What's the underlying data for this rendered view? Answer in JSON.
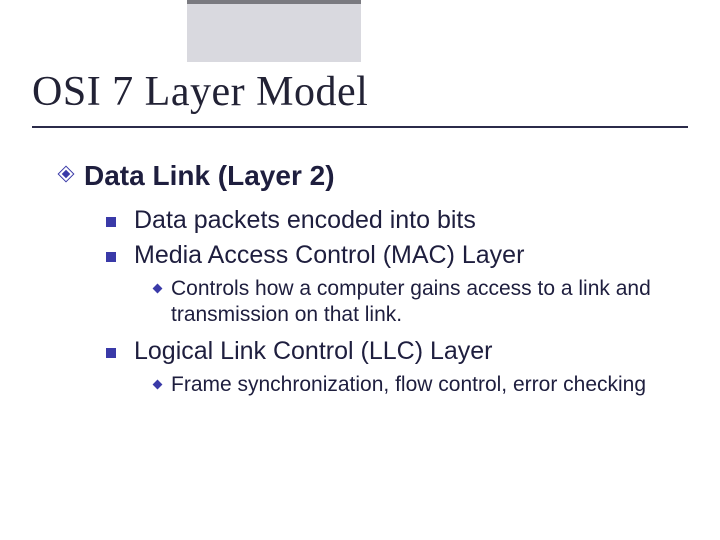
{
  "title": "OSI 7 Layer Model",
  "bullets": {
    "lvl1": {
      "text": "Data Link (Layer 2)"
    },
    "lvl2_items": [
      {
        "text": "Data packets encoded into bits"
      },
      {
        "text": "Media Access Control (MAC) Layer"
      },
      {
        "text": "Logical Link Control (LLC) Layer"
      }
    ],
    "lvl3_items": [
      {
        "text": "Controls how a computer gains access to a link and transmission on that link."
      },
      {
        "text": "Frame synchronization, flow control, error checking"
      }
    ]
  }
}
